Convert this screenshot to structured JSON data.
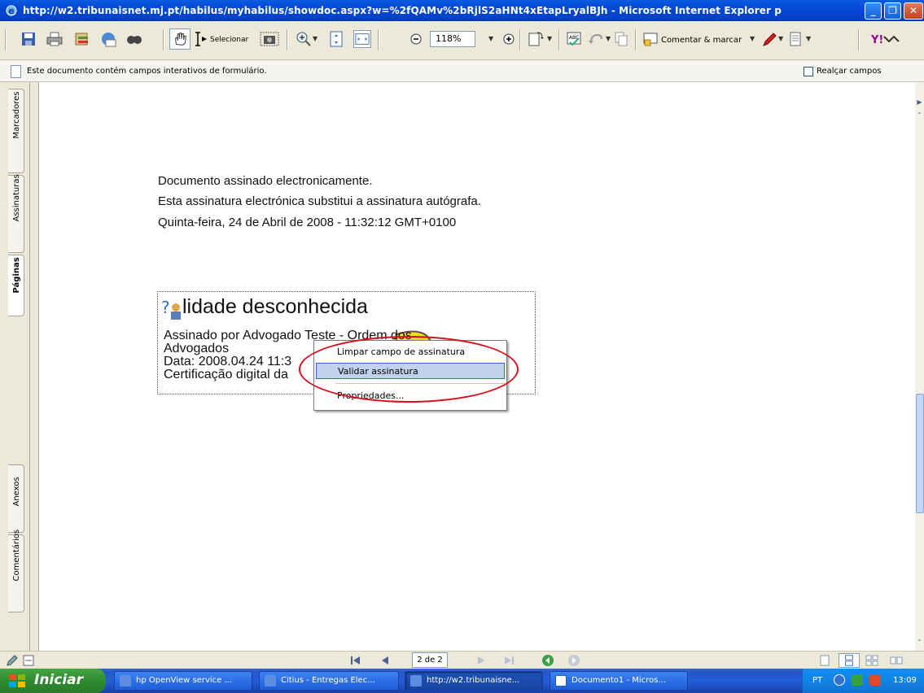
{
  "window": {
    "title": "http://w2.tribunaisnet.mj.pt/habilus/myhabilus/showdoc.aspx?w=%2fQAMv%2bRjlS2aHNt4xEtapLryalBJh - Microsoft Internet Explorer p"
  },
  "toolbar": {
    "select_label": "Selecionar",
    "zoom_value": "118%",
    "comment_label": "Comentar & marcar"
  },
  "infobar": {
    "text": "Este documento contém campos interativos de formulário.",
    "highlight_label": "Realçar campos"
  },
  "side_tabs": [
    "Marcadores",
    "Assinaturas",
    "Páginas",
    "Anexos",
    "Comentários"
  ],
  "document": {
    "lines": [
      "Documento assinado electronicamente.",
      "Esta assinatura electrónica substitui a assinatura autógrafa.",
      "Quinta-feira, 24 de Abril de 2008 - 11:32:12  GMT+0100"
    ],
    "signature": {
      "title": "lidade desconhecida",
      "line1": "Assinado por Advogado Teste - Ordem dos",
      "line2": "Advogados",
      "line3": "Data: 2008.04.24 11:3",
      "line4": "Certificação digital da"
    }
  },
  "context_menu": {
    "items": [
      "Limpar campo de assinatura",
      "Validar assinatura",
      "Propriedades..."
    ],
    "highlighted_index": 1
  },
  "navigation": {
    "page_indicator": "2 de 2"
  },
  "taskbar": {
    "start_label": "Iniciar",
    "tasks": [
      "hp OpenView service ...",
      "Citius - Entregas Elec...",
      "http://w2.tribunaisne...",
      "Documento1 - Micros..."
    ],
    "active_task_index": 2,
    "language": "PT",
    "clock": "13:09"
  },
  "colors": {
    "title_blue": "#0347d6",
    "highlight_red": "#d4101c",
    "menu_highlight": "#c1d2ee"
  }
}
